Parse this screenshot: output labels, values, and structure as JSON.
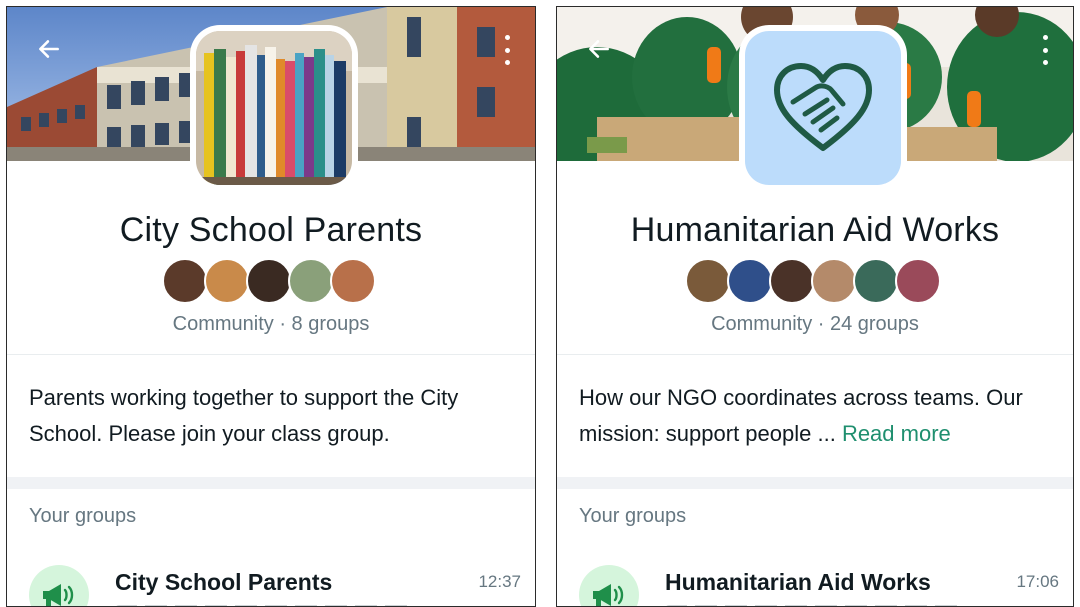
{
  "left": {
    "community_name": "City School Parents",
    "meta": "Community · 8 groups",
    "description": "Parents working together to support the City School. Please join your class group.",
    "section_title": "Your groups",
    "group": {
      "name": "City School Parents",
      "time": "12:37"
    }
  },
  "right": {
    "community_name": "Humanitarian Aid Works",
    "meta": "Community · 24 groups",
    "description": "How our NGO coordinates across teams. Our mission: support people ...",
    "read_more": "Read more",
    "section_title": "Your groups",
    "group": {
      "name": "Humanitarian Aid Works",
      "time": "17:06"
    }
  },
  "icons": {
    "back": "arrow-left-icon",
    "more": "more-vertical-icon",
    "group": "megaphone-icon",
    "community_logo": "heart-handshake-icon"
  },
  "colors": {
    "accent_green": "#1f8f6f",
    "group_icon_bg": "#d5f5dc",
    "logo_bg": "#bcdcfb",
    "logo_stroke": "#1f5a45"
  }
}
